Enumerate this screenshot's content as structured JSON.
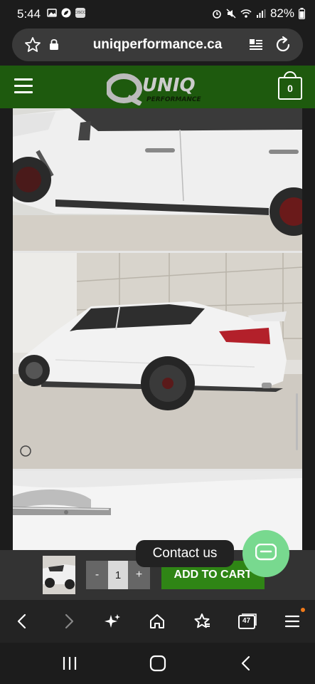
{
  "status_bar": {
    "time": "5:44",
    "battery": "82%"
  },
  "address_bar": {
    "url": "uniqperformance.ca"
  },
  "site_header": {
    "logo_alt": "UNIQ PERFORMANCE",
    "logo_main": "UNIQ",
    "logo_sub": "PERFORMANCE",
    "cart_count": "0"
  },
  "gallery": {
    "photos": [
      "car-side-detail",
      "car-rear-three-quarter",
      "door-handle-closeup"
    ]
  },
  "sticky_cart": {
    "qty_minus": "-",
    "qty_value": "1",
    "qty_plus": "+",
    "add_to_cart_label": "ADD TO CART"
  },
  "contact": {
    "label": "Contact us"
  },
  "browser_toolbar": {
    "tab_count": "47"
  },
  "colors": {
    "header_green": "#1e5a0e",
    "cart_button_green": "#2f8515",
    "contact_fab": "#78d98f",
    "notification_dot": "#f07a1a"
  }
}
